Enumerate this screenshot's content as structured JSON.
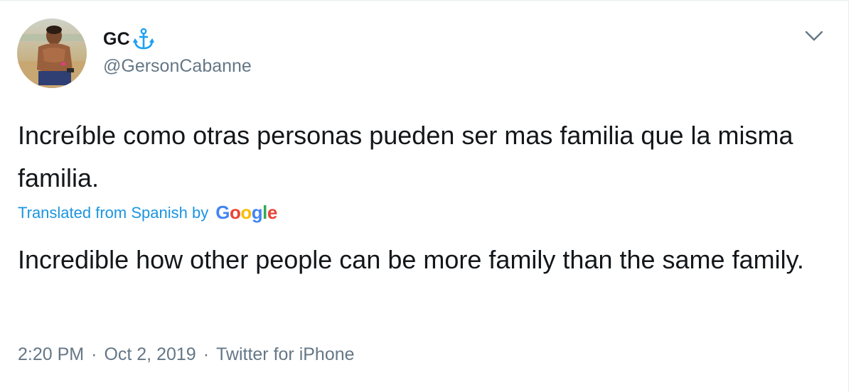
{
  "tweet": {
    "author": {
      "display_name": "GC",
      "badge_icon": "anchor-icon",
      "handle": "@GersonCabanne"
    },
    "menu_icon": "chevron-down-icon",
    "text_original": "Increíble como otras personas pueden ser mas familia que la misma familia.",
    "translation_note": "Translated from Spanish by",
    "translation_provider": {
      "letters": [
        "G",
        "o",
        "o",
        "g",
        "l",
        "e"
      ],
      "colors": [
        "#4285f4",
        "#ea4335",
        "#fbbc05",
        "#4285f4",
        "#34a853",
        "#ea4335"
      ]
    },
    "text_translated": "Incredible how other people can be more family than the same family.",
    "meta": {
      "time": "2:20 PM",
      "separator": "·",
      "date": "Oct 2, 2019",
      "source": "Twitter for iPhone"
    }
  },
  "colors": {
    "text_primary": "#14171a",
    "text_secondary": "#657786",
    "link": "#1b95e0",
    "border": "#e6ecf0",
    "anchor": "#1da1f2"
  }
}
